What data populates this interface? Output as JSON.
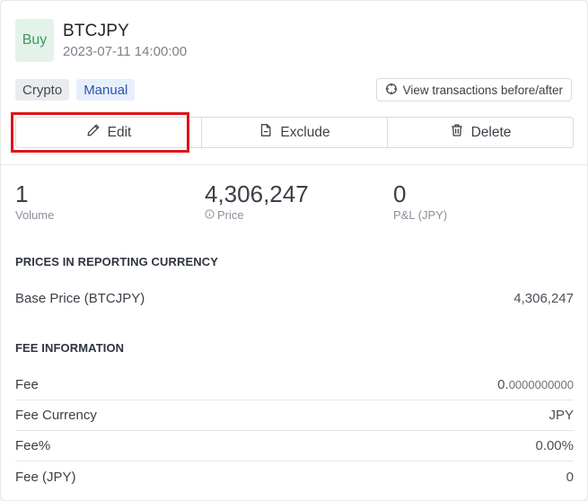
{
  "trade": {
    "side": "Buy",
    "symbol": "BTCJPY",
    "datetime": "2023-07-11 14:00:00",
    "tags": [
      "Crypto",
      "Manual"
    ],
    "view_transactions_label": "View transactions before/after"
  },
  "actions": {
    "edit": "Edit",
    "exclude": "Exclude",
    "delete": "Delete"
  },
  "stats": {
    "volume": {
      "value": "1",
      "label": "Volume"
    },
    "price": {
      "value": "4,306,247",
      "label": "Price"
    },
    "pnl": {
      "value": "0",
      "label": "P&L (JPY)"
    }
  },
  "prices_section": {
    "title": "PRICES IN REPORTING CURRENCY",
    "base_price_label": "Base Price (BTCJPY)",
    "base_price_value": "4,306,247"
  },
  "fee_section": {
    "title": "FEE INFORMATION",
    "fee_label": "Fee",
    "fee_value_int": "0.",
    "fee_value_dec": "0000000000",
    "fee_currency_label": "Fee Currency",
    "fee_currency_value": "JPY",
    "fee_pct_label": "Fee%",
    "fee_pct_value": "0.00%",
    "fee_jpy_label": "Fee (JPY)",
    "fee_jpy_value": "0"
  },
  "colors": {
    "buy_bg": "#e4f3e9",
    "buy_text": "#3a9a5e",
    "manual_text": "#2d55a6",
    "highlight": "#e0141a"
  }
}
